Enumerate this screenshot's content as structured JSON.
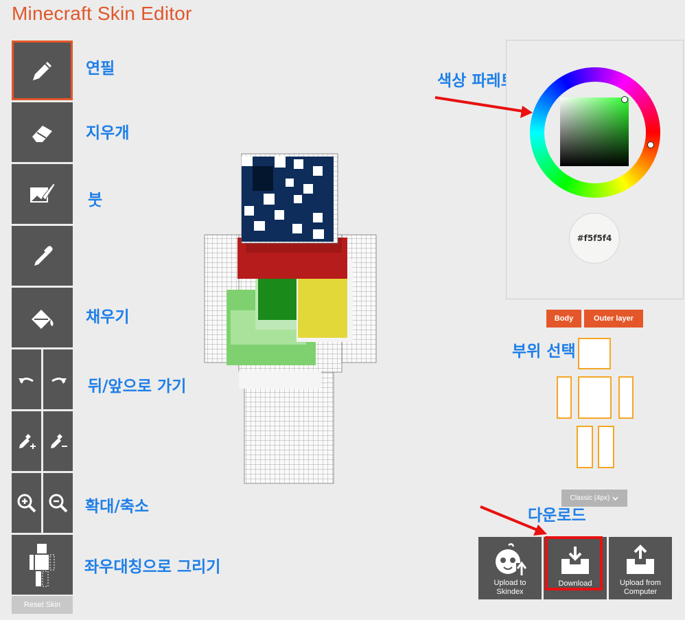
{
  "app": {
    "title": "Minecraft Skin Editor"
  },
  "tools": [
    {
      "id": "pencil",
      "icon": "pencil-icon",
      "active": true
    },
    {
      "id": "eraser",
      "icon": "eraser-icon"
    },
    {
      "id": "brush",
      "icon": "brush-icon"
    },
    {
      "id": "eyedropper",
      "icon": "eyedropper-icon"
    },
    {
      "id": "fill",
      "icon": "paint-bucket-icon"
    },
    {
      "id": "undo",
      "icon": "undo-icon"
    },
    {
      "id": "redo",
      "icon": "redo-icon"
    },
    {
      "id": "lighten",
      "icon": "lighten-icon"
    },
    {
      "id": "darken",
      "icon": "darken-icon"
    },
    {
      "id": "zoom-in",
      "icon": "zoom-in-icon"
    },
    {
      "id": "zoom-out",
      "icon": "zoom-out-icon"
    },
    {
      "id": "mirror",
      "icon": "mirror-icon"
    }
  ],
  "annotations": {
    "pencil": "연필",
    "eraser": "지우개",
    "brush": "붓",
    "fill": "채우기",
    "undo_redo": "뒤/앞으로 가기",
    "zoom": "확대/축소",
    "mirror": "좌우대칭으로 그리기",
    "palette": "색상 파레트",
    "part_select": "부위 선택",
    "download": "다운로드"
  },
  "reset_button": "Reset Skin",
  "color_picker": {
    "hex": "#f5f5f4"
  },
  "layer_buttons": {
    "body": "Body",
    "outer": "Outer layer"
  },
  "model_select": {
    "value": "Classic (4px)"
  },
  "actions": {
    "upload_skindex": "Upload to\nSkindex",
    "download": "Download",
    "upload_computer": "Upload from\nComputer"
  },
  "colors": {
    "accent": "#e4572a",
    "annotation": "#1e7fe8",
    "tool_bg": "#555555",
    "arrow": "#e81010",
    "part_border": "#f5a623"
  }
}
